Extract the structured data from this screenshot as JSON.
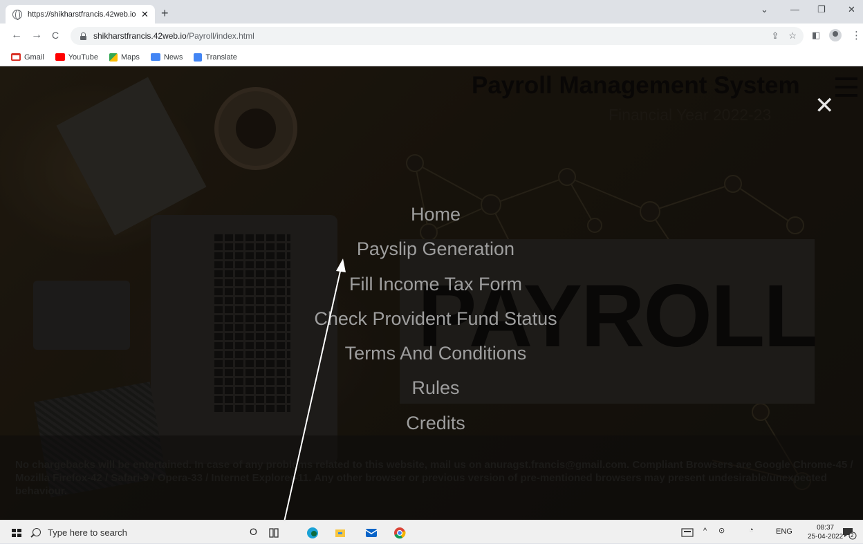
{
  "browser": {
    "tab_title": "https://shikharstfrancis.42web.io",
    "tab_close": "✕",
    "new_tab": "+",
    "url_host": "shikharstfrancis.42web.io",
    "url_path": "/Payroll/index.html",
    "win_minimize": "—",
    "win_restore": "❐",
    "win_close": "✕",
    "tab_dropdown": "⌄",
    "back": "←",
    "forward": "→",
    "reload": "C",
    "share": "⇪",
    "star": "☆",
    "sidepanel": "◧",
    "menu_dots": "⋮"
  },
  "bookmarks": [
    {
      "label": "Gmail",
      "color": "#d93025"
    },
    {
      "label": "YouTube",
      "color": "#ff0000"
    },
    {
      "label": "Maps",
      "color": "#34a853"
    },
    {
      "label": "News",
      "color": "#4285f4"
    },
    {
      "label": "Translate",
      "color": "#4285f4"
    }
  ],
  "site": {
    "title": "Payroll Management System",
    "subtitle": "Financial Year 2022-23",
    "banner_word": "PAYROLL",
    "close_symbol": "✕",
    "footer": "No chargebacks will be entertained. In case of any problems related to this website, mail us on anuragst.francis@gmail.com. Compliant Browsers are Google Chrome-45 / Mozilla Firefox-42 / Safari-9 / Opera-33 / Internet Explorer-11. Any other browser or previous version of pre-mentioned browsers may present undesirable/unexpected behaviour."
  },
  "menu": [
    "Home",
    "Payslip Generation",
    "Fill Income Tax Form",
    "Check Provident Fund Status",
    "Terms And Conditions",
    "Rules",
    "Credits"
  ],
  "taskbar": {
    "search_placeholder": "Type here to search",
    "cortana": "O",
    "lang": "ENG",
    "time": "08:37",
    "date": "25-04-2022",
    "notif_count": "2"
  }
}
